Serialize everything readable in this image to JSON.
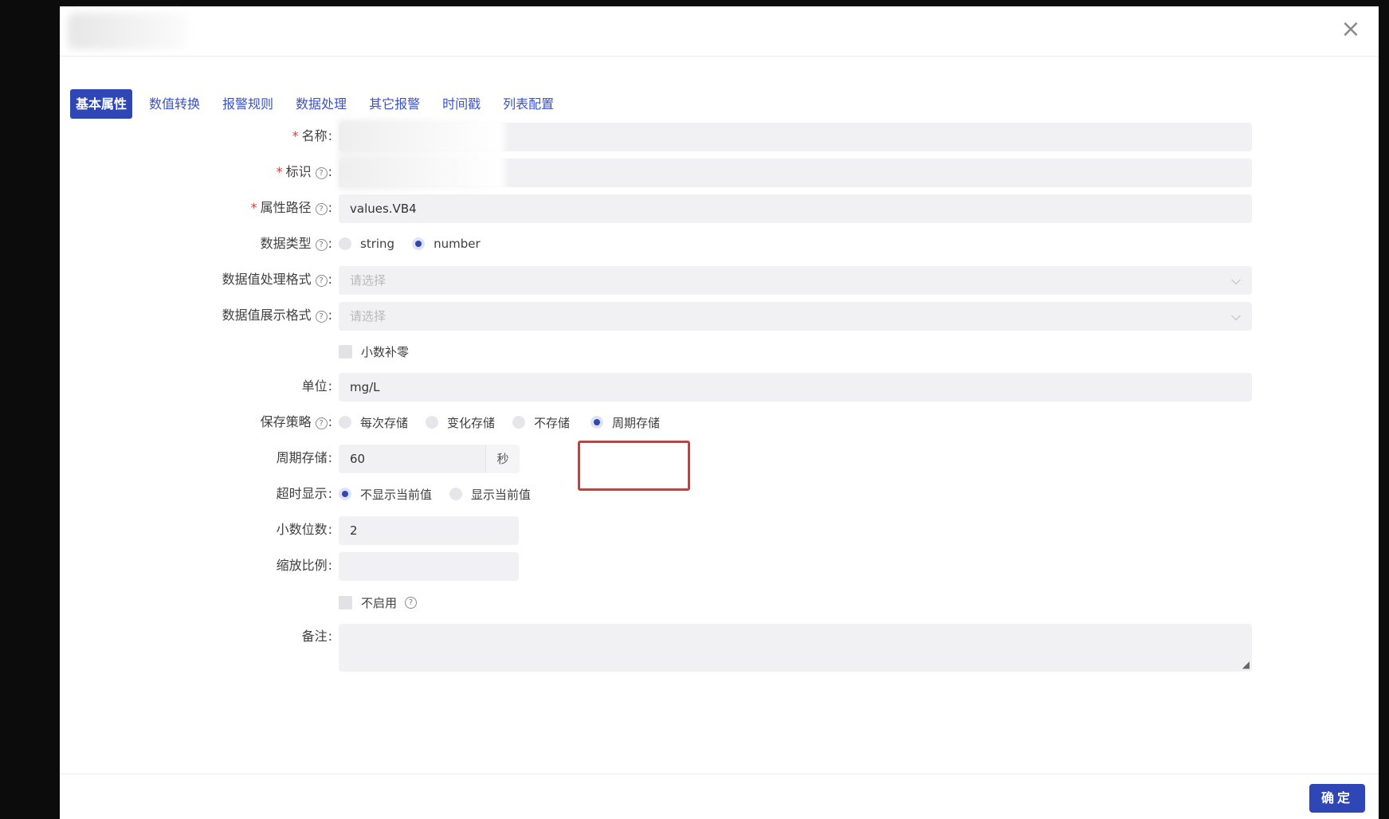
{
  "dialog": {
    "close_symbol": "×",
    "confirm_label": "确定"
  },
  "tabs": [
    {
      "label": "基本属性",
      "active": true
    },
    {
      "label": "数值转换"
    },
    {
      "label": "报警规则"
    },
    {
      "label": "数据处理"
    },
    {
      "label": "其它报警"
    },
    {
      "label": "时间戳"
    },
    {
      "label": "列表配置"
    }
  ],
  "form": {
    "name": {
      "label": "名称",
      "required": true,
      "value": ""
    },
    "identifier": {
      "label": "标识",
      "required": true,
      "value": ""
    },
    "attr_path": {
      "label": "属性路径",
      "required": true,
      "value": "values.VB4"
    },
    "data_type": {
      "label": "数据类型",
      "options": [
        "string",
        "number"
      ],
      "selected": "number"
    },
    "value_process_format": {
      "label": "数据值处理格式",
      "placeholder": "请选择"
    },
    "value_display_format": {
      "label": "数据值展示格式",
      "placeholder": "请选择"
    },
    "decimal_pad": {
      "label": "小数补零",
      "checked": false
    },
    "unit": {
      "label": "单位",
      "value": "mg/L"
    },
    "save_strategy": {
      "label": "保存策略",
      "options": [
        "每次存储",
        "变化存储",
        "不存储",
        "周期存储"
      ],
      "selected": "周期存储"
    },
    "period_storage": {
      "label": "周期存储",
      "value": "60",
      "suffix": "秒"
    },
    "timeout_display": {
      "label": "超时显示",
      "options": [
        "不显示当前值",
        "显示当前值"
      ],
      "selected": "不显示当前值"
    },
    "decimal_places": {
      "label": "小数位数",
      "value": "2"
    },
    "scale_ratio": {
      "label": "缩放比例",
      "value": ""
    },
    "disabled": {
      "label": "不启用",
      "checked": false
    },
    "remark": {
      "label": "备注",
      "value": ""
    }
  },
  "icons": {
    "help": "question-circle-icon",
    "close": "close-icon",
    "dropdown": "chevron-down-icon"
  },
  "colors": {
    "primary": "#2f47b6",
    "required": "#e53935",
    "highlight": "#e03434"
  }
}
